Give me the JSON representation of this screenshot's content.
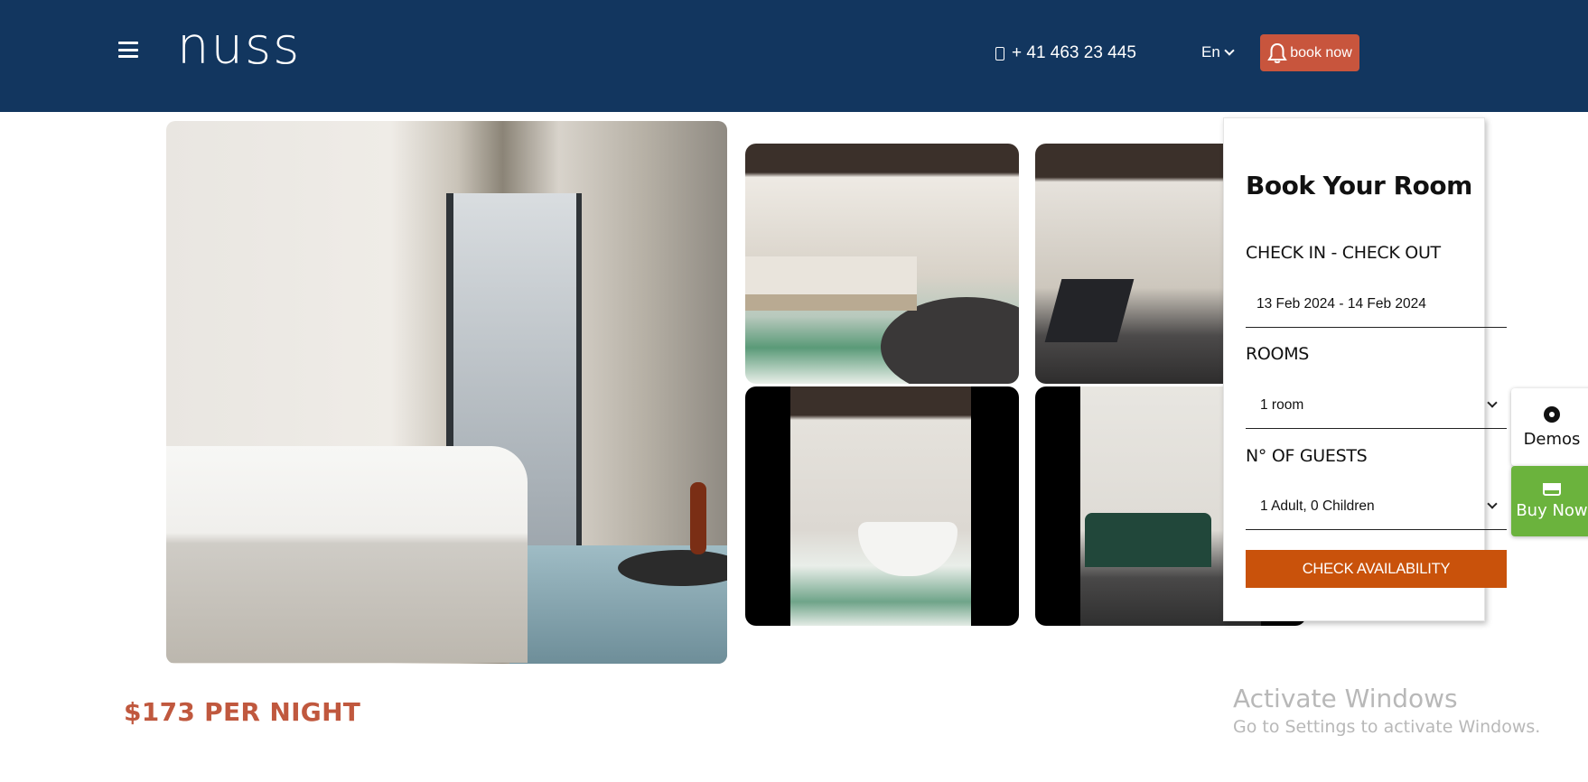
{
  "header": {
    "logo": "nuss",
    "phone": "+ 41 463 23 445",
    "language": "En",
    "book_now_label": "book now",
    "background_color": "#12365f",
    "accent_color": "#c8553d"
  },
  "gallery": {
    "images": [
      {
        "alt": "Bedroom with window and curtains"
      },
      {
        "alt": "Bedroom with wooden beams"
      },
      {
        "alt": "Lounge chair and round rug"
      },
      {
        "alt": "Bathroom with freestanding tub"
      },
      {
        "alt": "Living area with green sofa"
      }
    ]
  },
  "booking": {
    "title": "Book Your Room",
    "checkin_label": "CHECK IN - CHECK OUT",
    "checkin_value": "13 Feb 2024 - 14 Feb 2024",
    "rooms_label": "ROOMS",
    "rooms_value": "1 room",
    "guests_label": "N° OF GUESTS",
    "guests_value": "1 Adult, 0 Children",
    "button_label": "CHECK AVAILABILITY",
    "button_color": "#c9520b"
  },
  "side": {
    "demos_label": "Demos",
    "buy_now_label": "Buy Now",
    "buy_now_color": "#6bb33d"
  },
  "price": "$173 PER NIGHT",
  "watermark": {
    "title": "Activate Windows",
    "subtitle": "Go to Settings to activate Windows."
  }
}
